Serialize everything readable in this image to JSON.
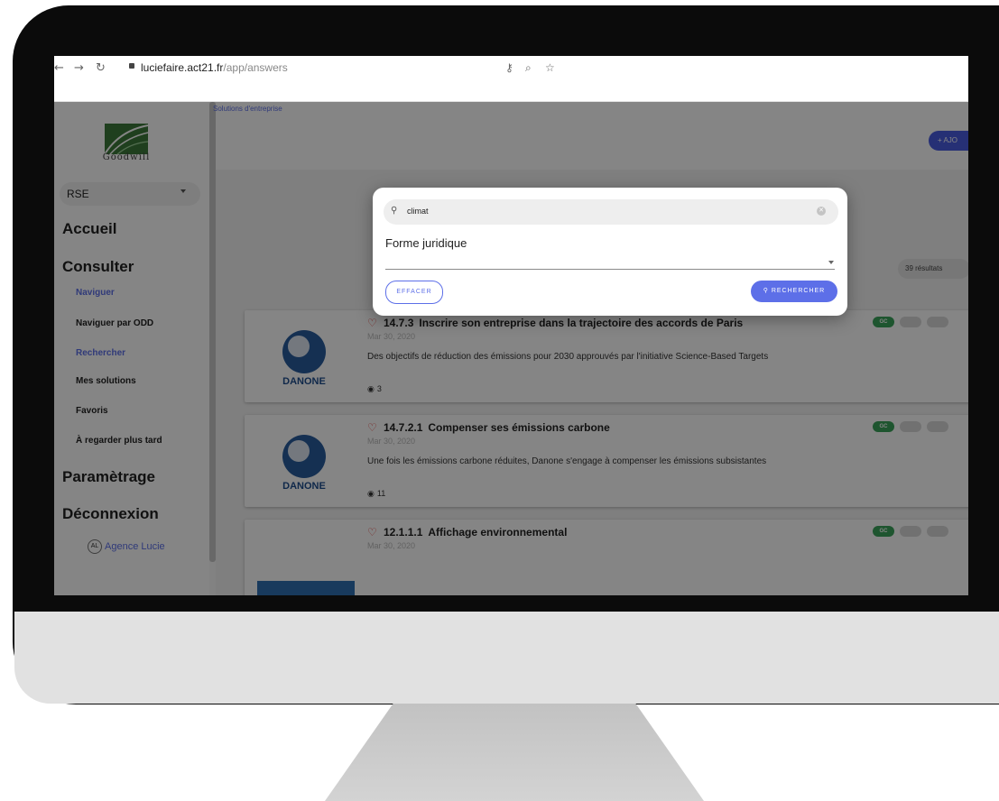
{
  "browser": {
    "url_host": "luciefaire.act21.fr",
    "url_path": "/app/answers",
    "back_icon": "back-arrow-icon",
    "forward_icon": "forward-arrow-icon",
    "reload_icon": "reload-icon"
  },
  "sidebar": {
    "logo_text": "Goodwill",
    "select_value": "RSE",
    "headings": {
      "home": "Accueil",
      "consult": "Consulter",
      "settings": "Paramètrage",
      "logout": "Déconnexion"
    },
    "items": [
      {
        "label": "Naviguer",
        "active": true
      },
      {
        "label": "Naviguer par ODD",
        "active": false
      },
      {
        "label": "Rechercher",
        "active": true
      },
      {
        "label": "Mes solutions",
        "active": false
      },
      {
        "label": "Favoris",
        "active": false
      },
      {
        "label": "À regarder plus tard",
        "active": false
      }
    ],
    "agency_badge": "AL",
    "agency": "Agence Lucie"
  },
  "main": {
    "breadcrumb": "Solutions d'entreprise",
    "add_label": "+ AJO",
    "results": "39 résultats"
  },
  "cards": [
    {
      "number": "14.7.3",
      "title": "Inscrire son entreprise dans la trajectoire des accords de Paris",
      "date": "Mar 30, 2020",
      "description": "Des objectifs de réduction des émissions pour 2030 approuvés par l'initiative Science-Based Targets",
      "views": "3",
      "brand": "DANONE",
      "tag": "GC"
    },
    {
      "number": "14.7.2.1",
      "title": "Compenser ses émissions carbone",
      "date": "Mar 30, 2020",
      "description": "Une fois les émissions carbone réduites, Danone s'engage à compenser les émissions subsistantes",
      "views": "11",
      "brand": "DANONE",
      "tag": "GC"
    },
    {
      "number": "12.1.1.1",
      "title": "Affichage environnemental",
      "date": "Mar 30, 2020",
      "tag": "GC"
    }
  ],
  "dialog": {
    "search_value": "climat",
    "field_label": "Forme juridique",
    "clear_label": "EFFACER",
    "search_label": "RECHERCHER"
  },
  "colors": {
    "accent": "#5d6fe8",
    "heart": "#e53935",
    "tag_green": "#3aa35a"
  }
}
